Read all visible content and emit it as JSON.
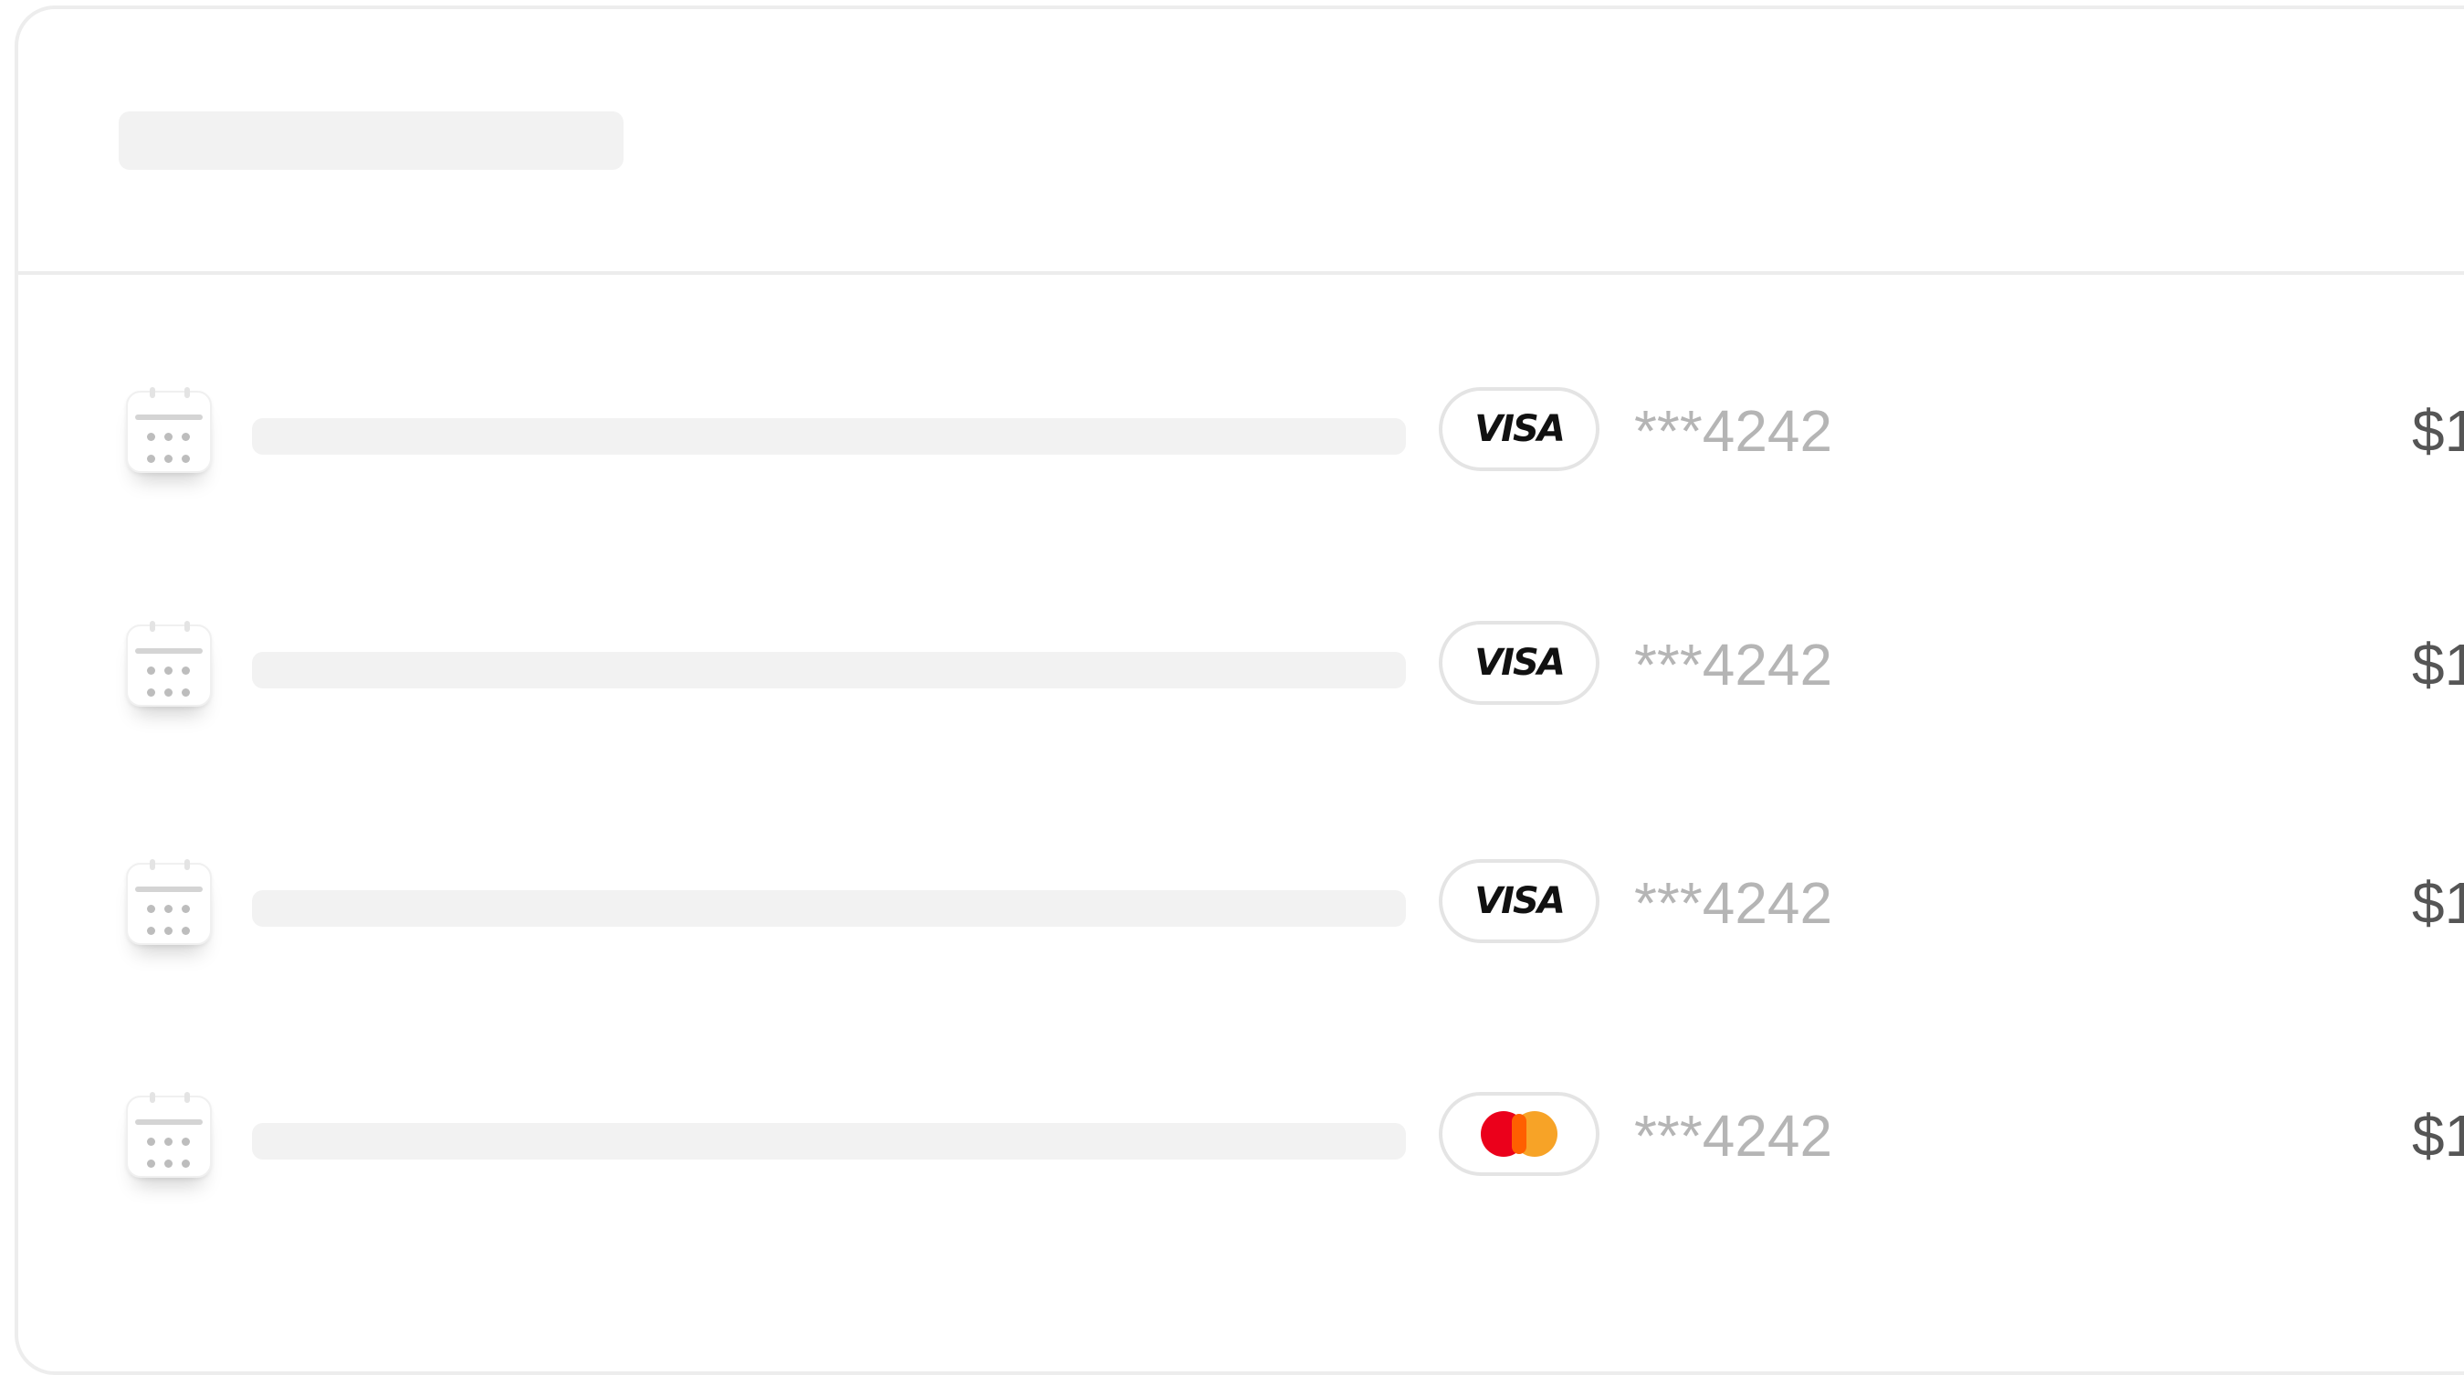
{
  "transactions": [
    {
      "card_brand": "VISA",
      "brand_icon": "visa-logo",
      "masked_number": "***4242",
      "amount": "$1"
    },
    {
      "card_brand": "VISA",
      "brand_icon": "visa-logo",
      "masked_number": "***4242",
      "amount": "$1"
    },
    {
      "card_brand": "VISA",
      "brand_icon": "visa-logo",
      "masked_number": "***4242",
      "amount": "$1"
    },
    {
      "card_brand": "",
      "brand_icon": "mastercard-logo",
      "masked_number": "***4242",
      "amount": "$1"
    }
  ],
  "icons": {
    "row_icon": "calendar-icon"
  },
  "colors": {
    "skeleton": "#f2f2f2",
    "border": "#ececec",
    "masked_text": "#b5b5b5",
    "amount_text": "#555555",
    "mastercard_red": "#eb001b",
    "mastercard_orange": "#f79e1b"
  }
}
